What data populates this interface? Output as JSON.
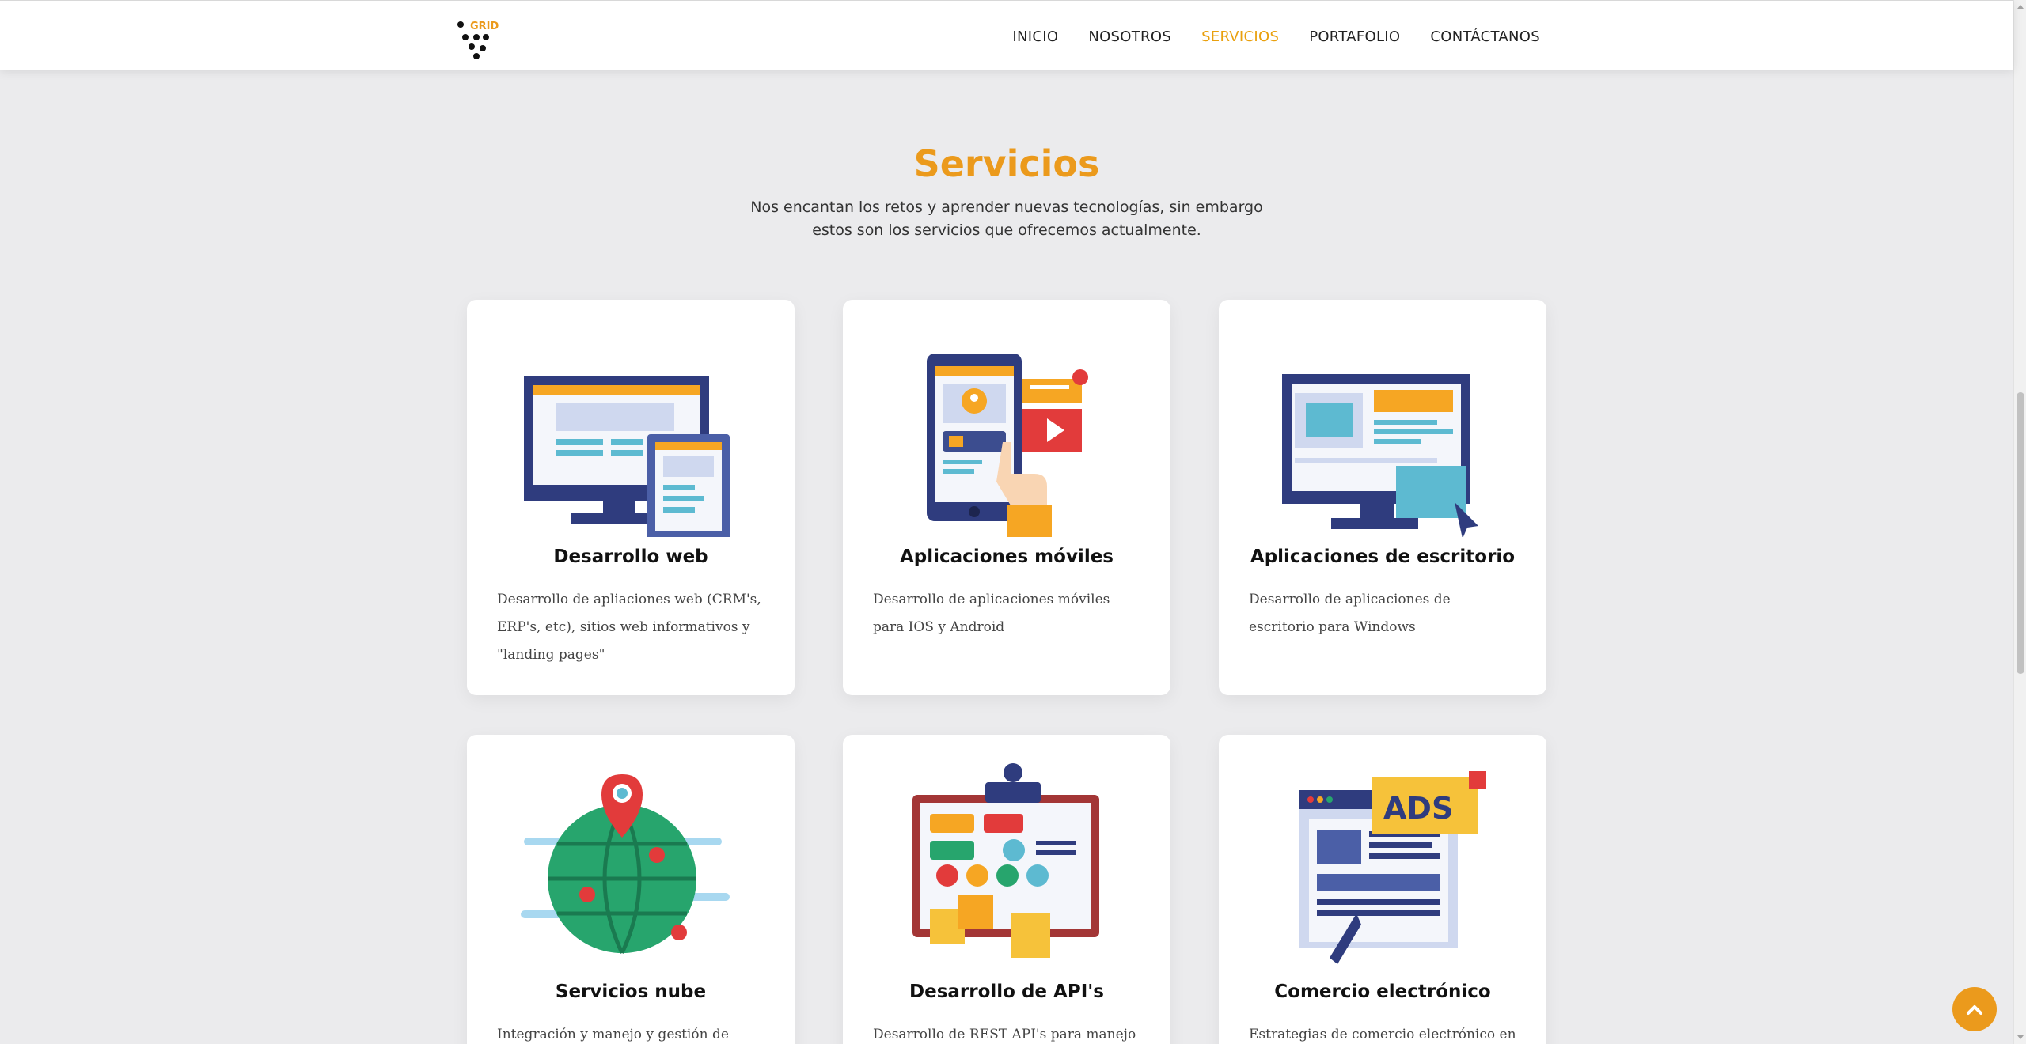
{
  "header": {
    "logo_text": "GRID",
    "nav": [
      {
        "label": "INICIO",
        "active": false
      },
      {
        "label": "NOSOTROS",
        "active": false
      },
      {
        "label": "SERVICIOS",
        "active": true
      },
      {
        "label": "PORTAFOLIO",
        "active": false
      },
      {
        "label": "CONTÁCTANOS",
        "active": false
      }
    ]
  },
  "section": {
    "title": "Servicios",
    "subtitle": "Nos encantan los retos y aprender nuevas tecnologías, sin embargo estos son los servicios que ofrecemos actualmente."
  },
  "cards": [
    {
      "title": "Desarrollo web",
      "description": "Desarrollo de apliaciones web (CRM's, ERP's, etc), sitios web informativos y \"landing pages\"",
      "icon": "web-development-illustration"
    },
    {
      "title": "Aplicaciones móviles",
      "description": "Desarrollo de aplicaciones móviles para IOS y Android",
      "icon": "mobile-apps-illustration"
    },
    {
      "title": "Aplicaciones de escritorio",
      "description": "Desarrollo de aplicaciones de escritorio para Windows",
      "icon": "desktop-apps-illustration"
    },
    {
      "title": "Servicios nube",
      "description": "Integración y manejo y gestión de servicios",
      "icon": "cloud-services-illustration"
    },
    {
      "title": "Desarrollo de API's",
      "description": "Desarrollo de REST API's para manejo de",
      "icon": "api-development-illustration"
    },
    {
      "title": "Comercio electrónico",
      "description": "Estrategias de comercio electrónico en las",
      "icon": "ecommerce-illustration"
    }
  ],
  "colors": {
    "accent": "#eb9a1c",
    "background": "#ebebed",
    "card": "#ffffff"
  }
}
